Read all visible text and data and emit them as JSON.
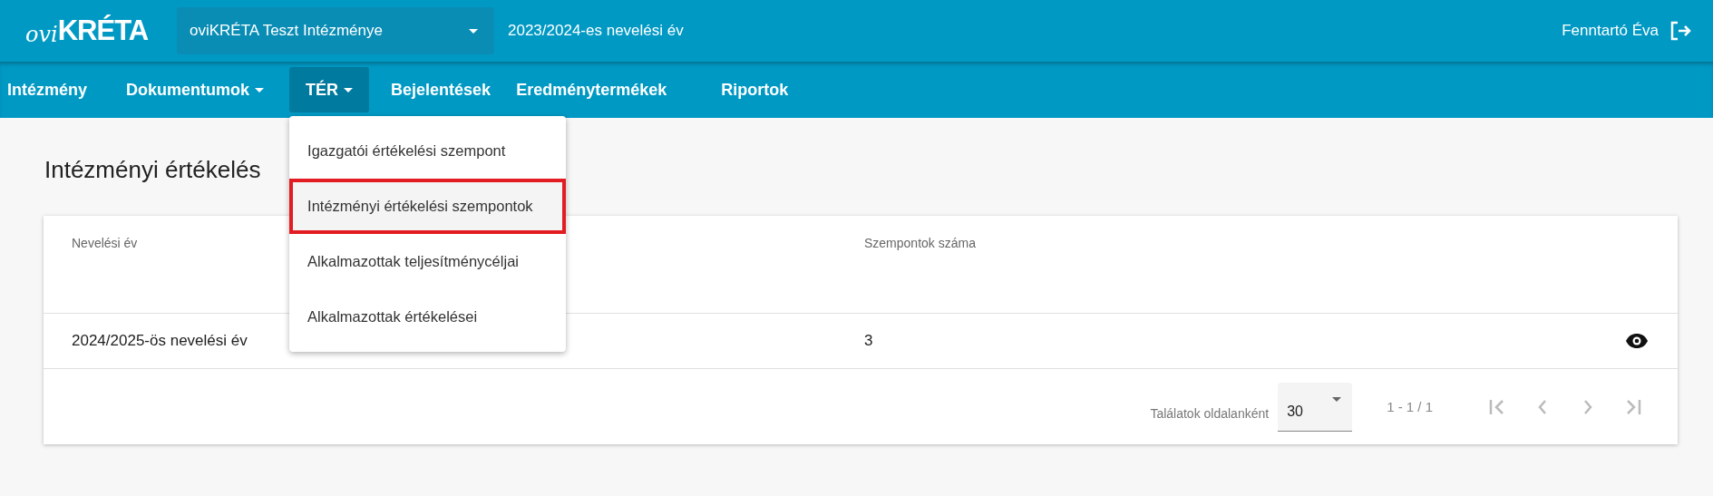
{
  "header": {
    "logo": {
      "script": "ovi",
      "word": "KRÉTA"
    },
    "institution_select": {
      "value": "oviKRÉTA Teszt Intézménye"
    },
    "school_year": "2023/2024-es nevelési év",
    "user": "Fenntartó Éva"
  },
  "nav": [
    {
      "label": "Intézmény",
      "has_menu": false,
      "selected": false
    },
    {
      "label": "Dokumentumok",
      "has_menu": true,
      "selected": false
    },
    {
      "label": "TÉR",
      "has_menu": true,
      "selected": true,
      "menu": [
        {
          "label": "Igazgatói értékelési szempont",
          "selected": false
        },
        {
          "label": "Intézményi értékelési szempontok",
          "selected": true
        },
        {
          "label": "Alkalmazottak teljesítménycéljai",
          "selected": false
        },
        {
          "label": "Alkalmazottak értékelései",
          "selected": false
        }
      ]
    },
    {
      "label": "Bejelentések",
      "has_menu": false,
      "selected": false
    },
    {
      "label": "Eredménytermékek",
      "has_menu": false,
      "selected": false
    },
    {
      "label": "Riportok",
      "has_menu": false,
      "selected": false
    }
  ],
  "page_title": "Intézményi értékelés",
  "table": {
    "columns": [
      "Nevelési év",
      "Szempontok száma"
    ],
    "rows": [
      {
        "cells": [
          "2024/2025-ös nevelési év",
          "3"
        ]
      }
    ]
  },
  "pager": {
    "label": "Találatok oldalanként",
    "page_size": "30",
    "range": "1 - 1 / 1",
    "buttons": [
      {
        "kind": "first",
        "disabled": true
      },
      {
        "kind": "prev",
        "disabled": true
      },
      {
        "kind": "next",
        "disabled": true
      },
      {
        "kind": "last",
        "disabled": true
      }
    ]
  }
}
